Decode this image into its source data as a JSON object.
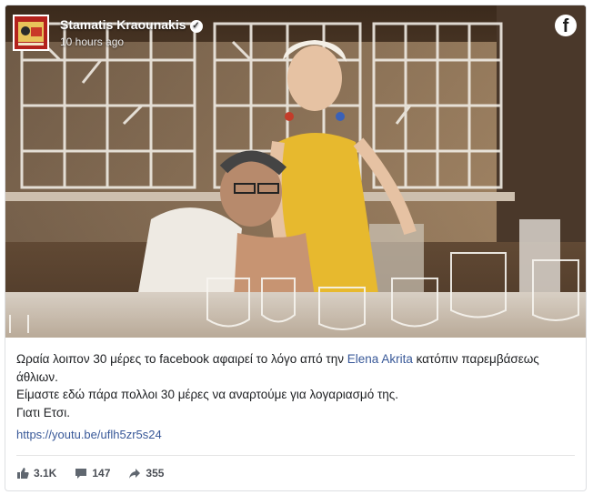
{
  "post": {
    "author": "Stamatis Kraounakis",
    "time": "10 hours ago",
    "text_before_link": "Ωραία λοιπον 30 μέρες το facebook αφαιρεί το λόγο από την ",
    "mention": "Elena Akrita",
    "text_after_link": " κατόπιν παρεμβάσεως άθλιων.",
    "line2": "Είμαστε εδώ πάρα πολλοι 30 μέρες να αναρτούμε για λογαριασμό της.",
    "line3": "Γιατι Ετσι.",
    "url": "https://youtu.be/uflh5zr5s24"
  },
  "stats": {
    "likes": "3.1K",
    "comments": "147",
    "shares": "355"
  },
  "icons": {
    "verified": "verified-badge-icon",
    "facebook": "facebook-logo-icon",
    "like": "thumbs-up-icon",
    "comment": "comment-bubble-icon",
    "share": "share-arrow-icon"
  },
  "colors": {
    "link": "#385898",
    "text": "#1c1e21",
    "muted": "#4b4f56"
  }
}
